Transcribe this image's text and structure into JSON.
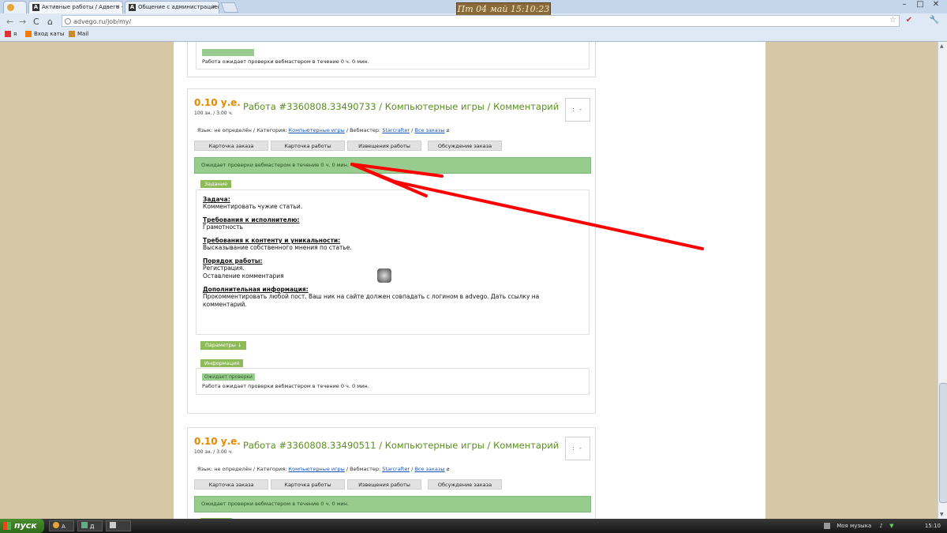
{
  "browser": {
    "tabs": [
      {
        "label": "Активные работы / Адвего -",
        "active": true
      },
      {
        "label": "Общение с администрацией",
        "active": false
      }
    ],
    "clock": "Пт 04 май 15:10:23",
    "url": "advego.ru/job/my/",
    "bookmarks": [
      "я",
      "Вход каты",
      "Mail"
    ]
  },
  "top_partial": {
    "text": "Работа ожидает проверки вебмастером в течение 0 ч. 0 мин."
  },
  "jobs": [
    {
      "price": "0.10 у.е.",
      "meta": "100 зн. / 3.00 ч.",
      "title": "Работа #3360808.33490733 / Компьютерные игры / Комментарий",
      "avatar": ": -",
      "info": {
        "lang": "Язык: не определён /",
        "cat_label": "Категория:",
        "cat_value": "Компьютерные игры",
        "webmaster_label": "/ Вебмастер:",
        "webmaster_value": "Starcrafter",
        "all_orders": "Все заказы"
      },
      "buttons": [
        "Карточка заказа",
        "Карточка работы",
        "Извещения работы",
        "Обсуждение заказа"
      ],
      "status": "Ожидает проверки вебмастером в течение 0 ч. 0 мин.",
      "task_label": "Задание",
      "task": [
        {
          "h": "Задача:",
          "t": [
            "Комментировать чужие статьи."
          ]
        },
        {
          "h": "Требования к исполнителю:",
          "t": [
            "Грамотность"
          ]
        },
        {
          "h": "Требования к контенту и уникальности:",
          "t": [
            "Высказывание собственного мнения по статье."
          ]
        },
        {
          "h": "Порядок работы:",
          "t": [
            "Регистрация.",
            "Оставление комментария"
          ]
        },
        {
          "h": "Дополнительная информация:",
          "t": [
            "Прокомментировать любой пост. Ваш ник на сайте должен совпадать с логином в advego. Дать ссылку на комментарий."
          ]
        }
      ],
      "params_label": "Параметры ↓",
      "info_label": "Информация",
      "chip": "Ожидает проверки",
      "info_text": "Работа ожидает проверки вебмастером в течение 0 ч. 0 мин."
    },
    {
      "price": "0.10 у.е.",
      "meta": "100 зн. / 3.00 ч.",
      "title": "Работа #3360808.33490511 / Компьютерные игры / Комментарий",
      "avatar": ": -",
      "info": {
        "lang": "Язык: не определён /",
        "cat_label": "Категория:",
        "cat_value": "Компьютерные игры",
        "webmaster_label": "/ Вебмастер:",
        "webmaster_value": "Starcrafter",
        "all_orders": "Все заказы"
      },
      "buttons": [
        "Карточка заказа",
        "Карточка работы",
        "Извещения работы",
        "Обсуждение заказа"
      ],
      "status": "Ожидает проверки вебмастером в течение 0 ч. 0 мин."
    }
  ],
  "taskbar": {
    "start": "пуск",
    "items": [
      "А",
      "Д",
      ""
    ],
    "tray_text": "Моя музыка",
    "time": "15:10"
  },
  "colors": {
    "accent_green": "#8dbb57",
    "status_green": "#98cc8f",
    "price_orange": "#e38a00",
    "title_green": "#5b8f1f",
    "annotation_red": "#ff0000"
  }
}
